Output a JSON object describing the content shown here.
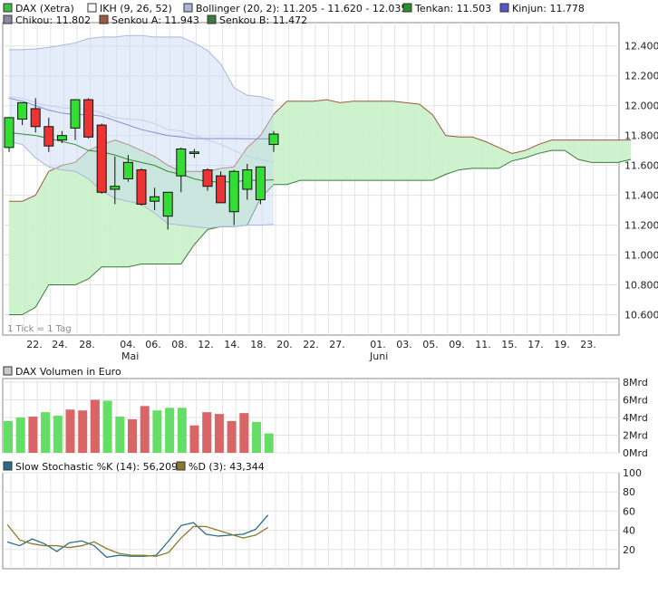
{
  "chart_data": [
    {
      "type": "candlestick",
      "panel": "price",
      "legend": [
        {
          "label": "DAX (Xetra)",
          "color": "#3fbf3f"
        },
        {
          "label": "IKH (9, 26, 52)",
          "color": "#ffffff"
        },
        {
          "label": "Bollinger (20, 2): 11.205 - 11.620 - 12.035",
          "color": "#a9b6de"
        },
        {
          "label": "Tenkan: 11.503",
          "color": "#2f8f2f"
        },
        {
          "label": "Kinjun: 11.778",
          "color": "#5555cc"
        },
        {
          "label": "Chikou: 11.802",
          "color": "#8888aa"
        },
        {
          "label": "Senkou A: 11.943",
          "color": "#9c5a3c"
        },
        {
          "label": "Senkou B: 11.472",
          "color": "#3a7a3a"
        }
      ],
      "annotation": "1 Tick = 1 Tag",
      "xlabels": [
        "22.",
        "24.",
        "28.",
        "04.",
        "06.",
        "08.",
        "12.",
        "14.",
        "18.",
        "20.",
        "22.",
        "27.",
        "01.",
        "03.",
        "05.",
        "09.",
        "11.",
        "15.",
        "17.",
        "19.",
        "23."
      ],
      "month_labels": [
        {
          "label": "Mai",
          "at": "04."
        },
        {
          "label": "Juni",
          "at": "01."
        }
      ],
      "ylabels": [
        "12.400",
        "12.200",
        "12.000",
        "11.800",
        "11.600",
        "11.400",
        "11.200",
        "11.000",
        "10.800",
        "10.600"
      ],
      "ylim": [
        10500,
        12550
      ],
      "candles": [
        {
          "o": 11720,
          "h": 11880,
          "l": 11690,
          "c": 11920
        },
        {
          "o": 11910,
          "h": 12000,
          "l": 11870,
          "c": 12020
        },
        {
          "o": 11980,
          "h": 12050,
          "l": 11820,
          "c": 11860
        },
        {
          "o": 11860,
          "h": 11920,
          "l": 11690,
          "c": 11730
        },
        {
          "o": 11770,
          "h": 11830,
          "l": 11750,
          "c": 11800
        },
        {
          "o": 11850,
          "h": 12040,
          "l": 11770,
          "c": 12040
        },
        {
          "o": 12040,
          "h": 12050,
          "l": 11780,
          "c": 11790
        },
        {
          "o": 11870,
          "h": 11880,
          "l": 11410,
          "c": 11420
        },
        {
          "o": 11440,
          "h": 11660,
          "l": 11340,
          "c": 11460
        },
        {
          "o": 11510,
          "h": 11670,
          "l": 11490,
          "c": 11620
        },
        {
          "o": 11570,
          "h": 11580,
          "l": 11330,
          "c": 11340
        },
        {
          "o": 11360,
          "h": 11450,
          "l": 11300,
          "c": 11390
        },
        {
          "o": 11260,
          "h": 11420,
          "l": 11170,
          "c": 11420
        },
        {
          "o": 11530,
          "h": 11720,
          "l": 11420,
          "c": 11710
        },
        {
          "o": 11680,
          "h": 11710,
          "l": 11650,
          "c": 11690
        },
        {
          "o": 11570,
          "h": 11580,
          "l": 11430,
          "c": 11460
        },
        {
          "o": 11530,
          "h": 11560,
          "l": 11350,
          "c": 11350
        },
        {
          "o": 11290,
          "h": 11570,
          "l": 11200,
          "c": 11560
        },
        {
          "o": 11440,
          "h": 11610,
          "l": 11370,
          "c": 11570
        },
        {
          "o": 11370,
          "h": 11590,
          "l": 11340,
          "c": 11590
        },
        {
          "o": 11740,
          "h": 11830,
          "l": 11690,
          "c": 11810
        }
      ],
      "bollinger_upper": [
        12375,
        12375,
        12380,
        12390,
        12405,
        12420,
        12450,
        12460,
        12460,
        12470,
        12470,
        12460,
        12460,
        12460,
        12420,
        12370,
        12280,
        12120,
        12070,
        12060,
        12035
      ],
      "bollinger_lower": [
        11760,
        11740,
        11650,
        11590,
        11570,
        11560,
        11510,
        11430,
        11380,
        11360,
        11340,
        11280,
        11210,
        11200,
        11190,
        11180,
        11190,
        11190,
        11200,
        11200,
        11205
      ],
      "bollinger_mid": [
        12060,
        12050,
        12020,
        12000,
        11985,
        11980,
        11980,
        11950,
        11920,
        11910,
        11905,
        11880,
        11840,
        11830,
        11800,
        11770,
        11740,
        11700,
        11660,
        11640,
        11620
      ],
      "kinjun": [
        12050,
        12030,
        12000,
        11970,
        11950,
        11940,
        11940,
        11930,
        11900,
        11870,
        11840,
        11820,
        11800,
        11790,
        11780,
        11780,
        11780,
        11780,
        11778,
        11778,
        11778
      ],
      "tenkan": [
        11820,
        11810,
        11800,
        11780,
        11760,
        11740,
        11700,
        11690,
        11670,
        11640,
        11620,
        11600,
        11560,
        11540,
        11510,
        11490,
        11490,
        11490,
        11500,
        11500,
        11503
      ],
      "senkou_a": [
        11360,
        11360,
        11400,
        11560,
        11600,
        11620,
        11700,
        11740,
        11770,
        11740,
        11700,
        11660,
        11600,
        11560,
        11560,
        11560,
        11580,
        11590,
        11720,
        11800,
        11943,
        12030,
        12030,
        12030,
        12040,
        12020,
        12030,
        12030,
        12030,
        12030,
        12020,
        12010,
        11940,
        11800,
        11790,
        11790,
        11760,
        11720,
        11680,
        11700,
        11740,
        11770,
        11770,
        11770,
        11770,
        11770,
        11770,
        11770
      ],
      "senkou_b": [
        10600,
        10600,
        10650,
        10800,
        10800,
        10800,
        10840,
        10920,
        10920,
        10920,
        10940,
        10940,
        10940,
        10940,
        11070,
        11170,
        11190,
        11190,
        11200,
        11380,
        11472,
        11472,
        11500,
        11500,
        11500,
        11500,
        11500,
        11500,
        11500,
        11500,
        11500,
        11500,
        11500,
        11540,
        11570,
        11580,
        11580,
        11580,
        11630,
        11650,
        11680,
        11700,
        11700,
        11640,
        11620,
        11620,
        11620,
        11640
      ]
    },
    {
      "type": "bar",
      "panel": "volume",
      "title": "DAX Volumen in Euro",
      "legend_color": "#c8c8c8",
      "ylabels": [
        "8Mrd",
        "6Mrd",
        "4Mrd",
        "2Mrd",
        "0Mrd"
      ],
      "ylim": [
        0,
        8
      ],
      "unit": "Mrd",
      "values": [
        3.6,
        4.0,
        4.1,
        4.6,
        4.2,
        4.9,
        4.8,
        6.0,
        5.9,
        4.1,
        3.8,
        5.3,
        4.8,
        5.1,
        5.1,
        3.1,
        4.6,
        4.4,
        3.6,
        4.5,
        3.5,
        2.2
      ],
      "up": [
        true,
        true,
        false,
        true,
        true,
        false,
        false,
        false,
        true,
        true,
        false,
        false,
        true,
        true,
        true,
        false,
        false,
        false,
        false,
        false,
        true,
        true
      ]
    },
    {
      "type": "line",
      "panel": "stochastic",
      "ylabels": [
        "100",
        "80",
        "60",
        "40",
        "20"
      ],
      "ylim": [
        0,
        100
      ],
      "series": [
        {
          "name": "Slow Stochastic %K (14): 56,209",
          "color": "#2a6f8a",
          "values": [
            28,
            24,
            31,
            26,
            18,
            27,
            29,
            24,
            12,
            14,
            13,
            13,
            14,
            29,
            45,
            48,
            36,
            34,
            35,
            36,
            41,
            56
          ]
        },
        {
          "name": "%D (3): 43,344",
          "color": "#8b7a2a",
          "values": [
            46,
            30,
            26,
            24,
            24,
            22,
            24,
            28,
            21,
            16,
            14,
            14,
            13,
            17,
            32,
            44,
            44,
            40,
            36,
            32,
            35,
            43
          ]
        }
      ]
    }
  ]
}
